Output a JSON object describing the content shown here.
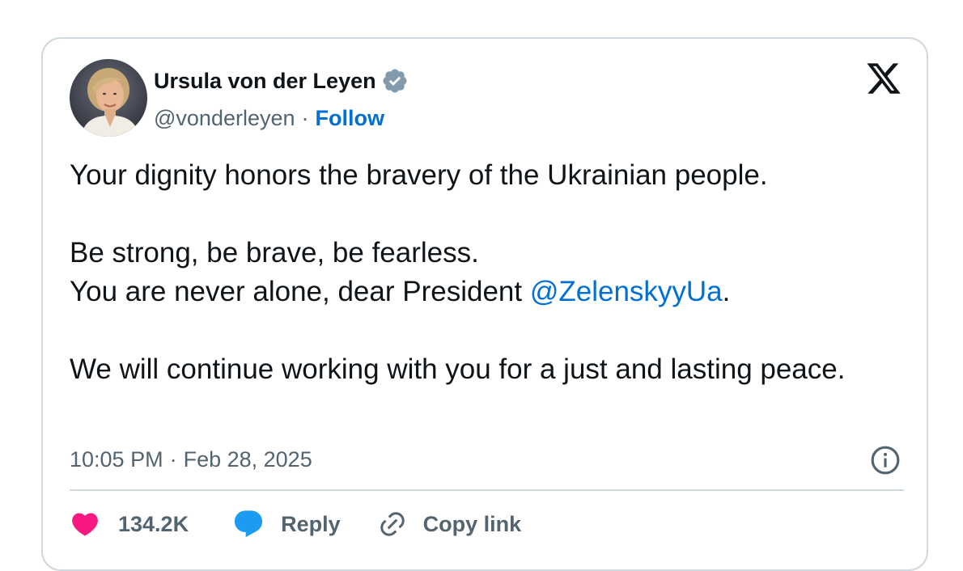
{
  "author": {
    "display_name": "Ursula von der Leyen",
    "handle": "@vonderleyen",
    "separator": "·",
    "follow_label": "Follow",
    "verified_icon": "verified-badge-icon"
  },
  "tweet": {
    "line1": "Your dignity honors the bravery of the Ukrainian people.",
    "line2": "Be strong, be brave, be fearless.",
    "line3_prefix": "You are never alone, dear President ",
    "line3_mention": "@ZelenskyyUa",
    "line3_suffix": ".",
    "line4": "We will continue working with you for a just and lasting peace."
  },
  "meta": {
    "time": "10:05 PM",
    "separator": "·",
    "date": "Feb 28, 2025"
  },
  "actions": {
    "like_count": "134.2K",
    "reply_label": "Reply",
    "copy_label": "Copy link"
  },
  "colors": {
    "link": "#006fd6",
    "like": "#f91880",
    "reply": "#1d9bf0",
    "muted": "#536471",
    "border": "#cfd9de"
  }
}
